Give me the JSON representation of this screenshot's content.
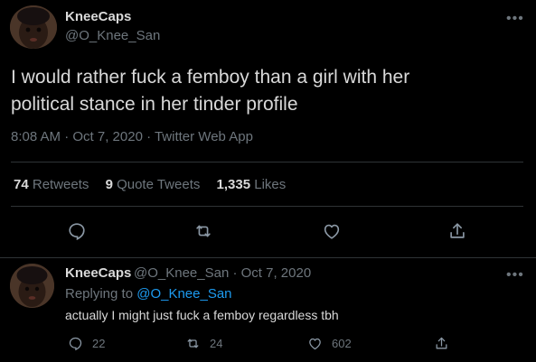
{
  "tweet": {
    "display_name": "KneeCaps",
    "handle": "@O_Knee_San",
    "more_icon": "more-horizontal-icon",
    "text_line1": "I would rather fuck a femboy than a girl with her",
    "text_line2": "political stance in her tinder profile",
    "timestamp": "8:08 AM · Oct 7, 2020 · Twitter Web App",
    "stats": {
      "retweets_count": "74",
      "retweets_label": "Retweets",
      "quotes_count": "9",
      "quotes_label": "Quote Tweets",
      "likes_count": "1,335",
      "likes_label": "Likes"
    },
    "actions": [
      "reply-icon",
      "retweet-icon",
      "like-icon",
      "share-icon"
    ]
  },
  "reply": {
    "display_name": "KneeCaps",
    "handle_date": "@O_Knee_San · Oct 7, 2020",
    "replying_prefix": "Replying to",
    "replying_to": "@O_Knee_San",
    "text": "actually I might just fuck a femboy regardless tbh",
    "reply_count": "22",
    "retweet_count": "24",
    "like_count": "602"
  },
  "colors": {
    "background": "#000000",
    "primary_text": "#d9d9d9",
    "secondary_text": "#6e767d",
    "link": "#1d9bf0",
    "divider": "#2f3336"
  }
}
